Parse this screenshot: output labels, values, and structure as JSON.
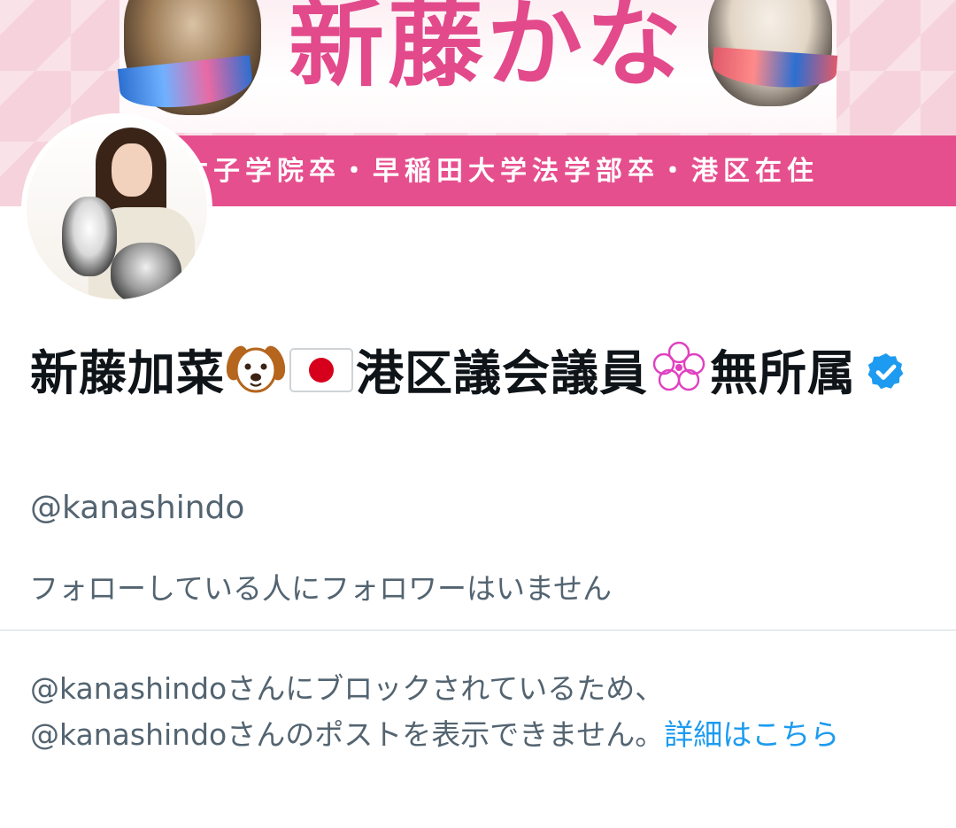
{
  "banner": {
    "name_text": "新藤かな",
    "strip_text": "女子学院卒・早稲田大学法学部卒・港区在住"
  },
  "profile": {
    "name_part1": "新藤加菜",
    "name_part2": "港区議会議員",
    "name_part3": "無所属",
    "icons": [
      "dog-face-icon",
      "japan-flag-icon",
      "flower-icon",
      "verified-badge-icon"
    ],
    "handle": "@kanashindo",
    "followers_note": "フォローしている人にフォロワーはいません"
  },
  "blocked": {
    "message_line1": "@kanashindoさんにブロックされているため、",
    "message_line2": "@kanashindoさんのポストを表示できません。",
    "learn_more": "詳細はこちら"
  },
  "colors": {
    "accent": "#1d9bf0",
    "secondary_text": "#536471",
    "banner_pink": "#e64f8e"
  }
}
